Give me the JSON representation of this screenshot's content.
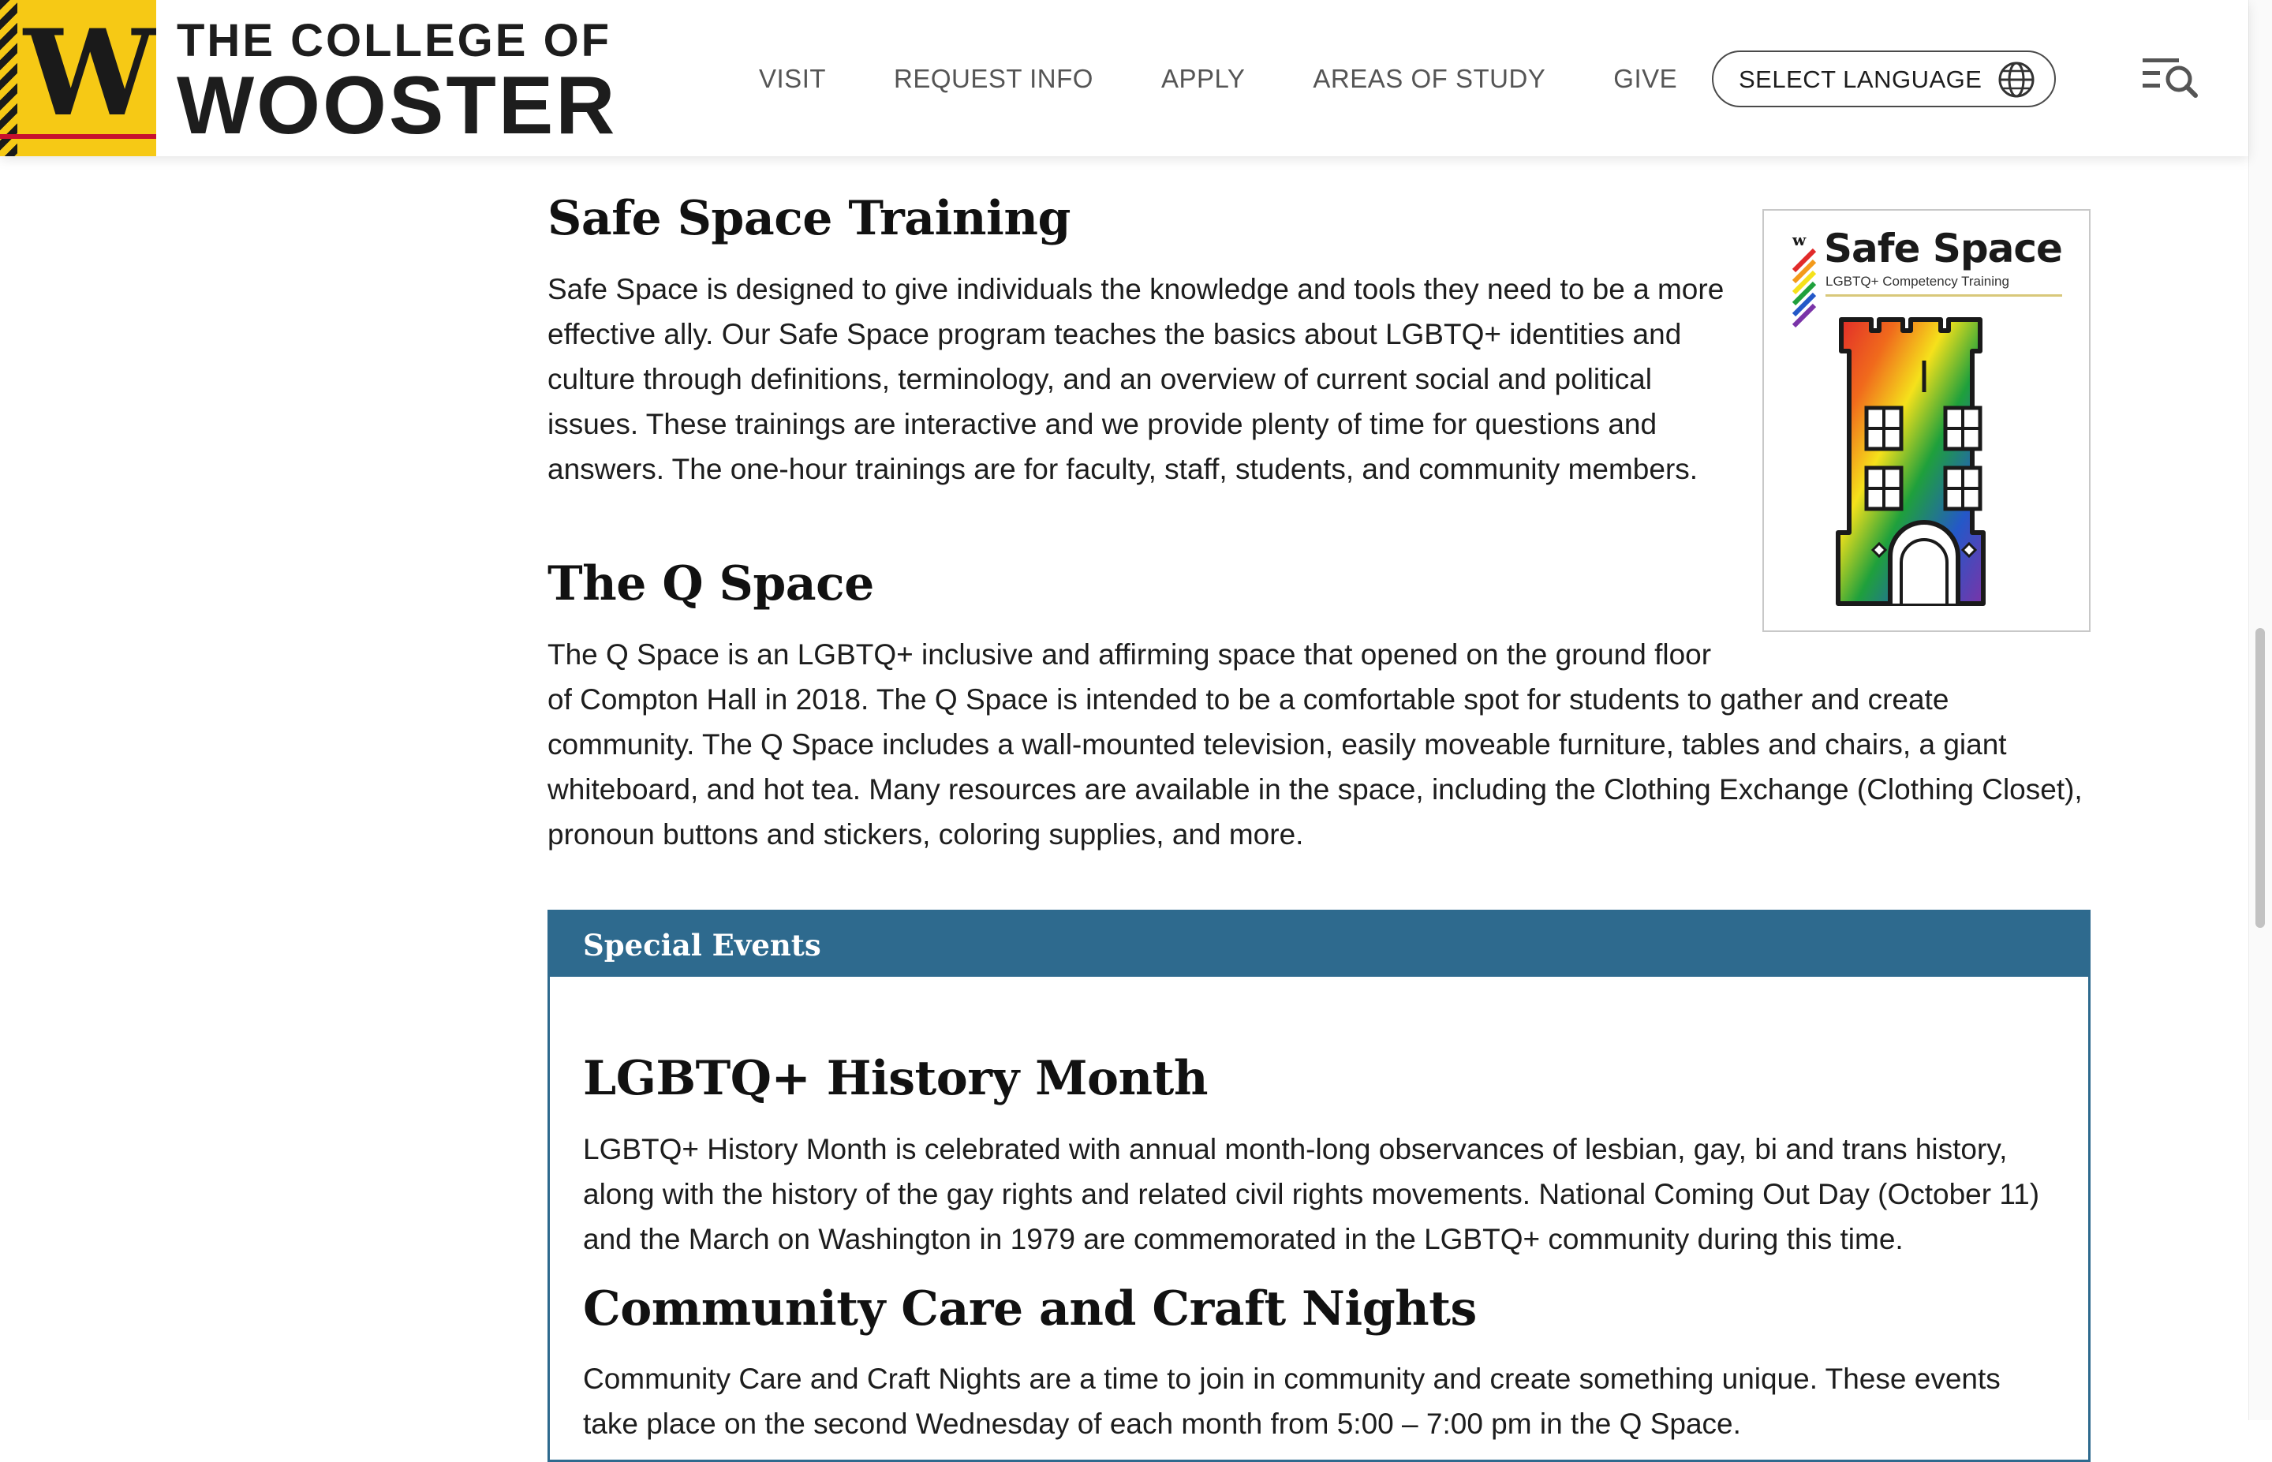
{
  "header": {
    "logo_letter": "W",
    "wordmark_top": "THE COLLEGE OF",
    "wordmark_bottom": "WOOSTER",
    "nav": [
      "VISIT",
      "REQUEST INFO",
      "APPLY",
      "AREAS OF STUDY",
      "GIVE"
    ],
    "language_button": "SELECT LANGUAGE",
    "language_icon": "globe-icon",
    "menu_icon": "menu-search-icon"
  },
  "sections": [
    {
      "title": "Safe Space Training",
      "text": "Safe Space is designed to give individuals the knowledge and tools they need to be a more effective ally. Our Safe Space program teaches the basics about LGBTQ+ identities and culture through definitions, terminology, and an overview of current social and political issues. These trainings are interactive and we provide plenty of time for questions and answers. The one-hour trainings are for faculty, staff, students, and community members."
    },
    {
      "title": "The Q Space",
      "text": "The Q Space is an LGBTQ+ inclusive and affirming space that opened on the ground floor of Compton Hall in 2018. The Q Space is intended to be a comfortable spot for students to gather and create community. The Q Space includes a wall-mounted television, easily moveable furniture, tables and chairs, a giant whiteboard, and hot tea. Many resources are available in the space, including the Clothing Exchange (Clothing Closet), pronoun buttons and stickers, coloring supplies, and more."
    }
  ],
  "poster": {
    "title": "Safe Space",
    "subtitle": "LGBTQ+ Competency Training",
    "mark": "W"
  },
  "events": {
    "heading": "Special Events",
    "items": [
      {
        "title": "LGBTQ+ History Month",
        "text": "LGBTQ+ History Month is celebrated with annual month-long observances of lesbian, gay, bi and trans history, along with the history of the gay rights and related civil rights movements. National Coming Out Day (October 11) and the March on Washington in 1979 are commemorated in the LGBTQ+ community during this time."
      },
      {
        "title": "Community Care and Craft Nights",
        "text": "Community Care and Craft Nights are a time to join in community and create something unique. These events take place on the second Wednesday of each month from 5:00 – 7:00 pm in the Q Space."
      }
    ]
  },
  "colors": {
    "brand_gold": "#f6c915",
    "brand_black": "#1a1a1a",
    "events_blue": "#2e6a8e"
  }
}
